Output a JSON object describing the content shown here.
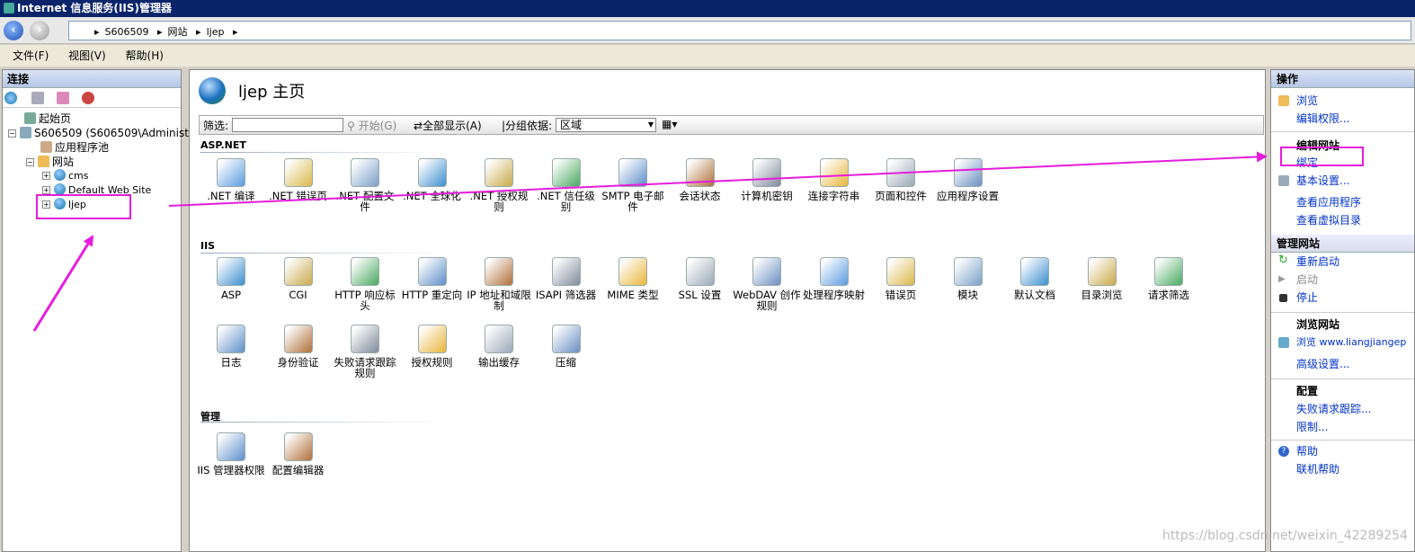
{
  "window": {
    "title": "Internet 信息服务(IIS)管理器"
  },
  "nav": {
    "crumbs": [
      "S606509",
      "网站",
      "ljep"
    ]
  },
  "menu": [
    "文件(F)",
    "视图(V)",
    "帮助(H)"
  ],
  "connections": {
    "header": "连接",
    "tree": [
      {
        "label": "起始页"
      },
      {
        "label": "S606509 (S606509\\Administr"
      },
      {
        "label": "应用程序池"
      },
      {
        "label": "网站"
      },
      {
        "label": "cms"
      },
      {
        "label": "Default Web Site"
      },
      {
        "label": "ljep"
      }
    ]
  },
  "main": {
    "title": "ljep 主页",
    "filter_label": "筛选:",
    "start_label": "开始(G)",
    "show_all_label": "全部显示(A)",
    "group_label": "分组依据:",
    "group_value": "区域",
    "sections": [
      {
        "name": "ASP.NET",
        "items": [
          ".NET 编译",
          ".NET 错误页",
          ".NET 配置文件",
          ".NET 全球化",
          ".NET 授权规则",
          ".NET 信任级别",
          "SMTP 电子邮件",
          "会话状态",
          "计算机密钥",
          "连接字符串",
          "页面和控件",
          "应用程序设置"
        ]
      },
      {
        "name": "IIS",
        "items": [
          "ASP",
          "CGI",
          "HTTP 响应标头",
          "HTTP 重定向",
          "IP 地址和域限制",
          "ISAPI 筛选器",
          "MIME 类型",
          "SSL 设置",
          "WebDAV 创作规则",
          "处理程序映射",
          "错误页",
          "模块",
          "默认文档",
          "目录浏览",
          "请求筛选",
          "日志",
          "身份验证",
          "失败请求跟踪规则",
          "授权规则",
          "输出缓存",
          "压缩"
        ]
      },
      {
        "name": "管理",
        "items": [
          "IIS 管理器权限",
          "配置编辑器"
        ]
      }
    ]
  },
  "actions": {
    "header": "操作",
    "browse": "浏览",
    "edit_perms": "编辑权限...",
    "edit_site": "编辑网站",
    "bindings": "绑定...",
    "basic_settings": "基本设置...",
    "view_apps": "查看应用程序",
    "view_vdirs": "查看虚拟目录",
    "manage_site": "管理网站",
    "restart": "重新启动",
    "start": "启动",
    "stop": "停止",
    "browse_site": "浏览网站",
    "browse_url": "浏览 www.liangjiangep",
    "advanced": "高级设置...",
    "config": "配置",
    "failed_trace": "失败请求跟踪...",
    "limits": "限制...",
    "help": "帮助",
    "online_help": "联机帮助"
  },
  "watermark": "https://blog.csdn.net/weixin_42289254",
  "colors": {
    "highlight": "#e61cdc",
    "link": "#0033cc",
    "header": "#0a246a"
  }
}
